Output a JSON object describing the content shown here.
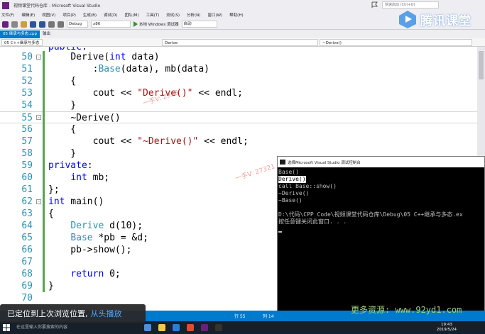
{
  "titlebar": {
    "title": "视频课堂代码仓库 - Microsoft Visual Studio",
    "quick_launch": "快速启动 (Ctrl+Q)"
  },
  "menubar": {
    "items": [
      "文件(F)",
      "编辑(E)",
      "视图(V)",
      "项目(P)",
      "生成(B)",
      "调试(D)",
      "团队(M)",
      "工具(T)",
      "测试(S)",
      "分析(N)",
      "窗口(W)",
      "帮助(H)"
    ]
  },
  "toolbar": {
    "config": "Debug",
    "platform": "x86",
    "run_label": "本地 Windows 调试器",
    "run_mode": "自动"
  },
  "logo": {
    "text": "腾讯课堂"
  },
  "doctabs": [
    {
      "label": "05 继承与多态.cpp",
      "active": true
    },
    {
      "label": "输出",
      "active": false
    }
  ],
  "navbar": {
    "project": "05 C++继承与多态",
    "scope": "Derive",
    "member": "~Derive()"
  },
  "code": [
    {
      "n": "50",
      "tokens": [
        [
          "",
          "    "
        ],
        [
          "",
          "Derive("
        ],
        [
          "kw",
          "int"
        ],
        [
          "",
          " data)"
        ]
      ]
    },
    {
      "n": "51",
      "tokens": [
        [
          "",
          "        :"
        ],
        [
          "cls",
          "Base"
        ],
        [
          "",
          "(data), mb(data)"
        ]
      ]
    },
    {
      "n": "52",
      "tokens": [
        [
          "",
          "    {"
        ]
      ]
    },
    {
      "n": "53",
      "tokens": [
        [
          "",
          "        cout << "
        ],
        [
          "str",
          "\"Derive()\""
        ],
        [
          "",
          " << endl;"
        ]
      ]
    },
    {
      "n": "54",
      "tokens": [
        [
          "",
          "    }"
        ]
      ]
    },
    {
      "n": "55",
      "tokens": [
        [
          "",
          "    ~Derive()"
        ]
      ]
    },
    {
      "n": "56",
      "tokens": [
        [
          "",
          "    {"
        ]
      ]
    },
    {
      "n": "57",
      "tokens": [
        [
          "",
          "        cout << "
        ],
        [
          "str",
          "\"~Derive()\""
        ],
        [
          "",
          " << endl;"
        ]
      ]
    },
    {
      "n": "58",
      "tokens": [
        [
          "",
          "    }"
        ]
      ]
    },
    {
      "n": "59",
      "tokens": [
        [
          "kw",
          "private"
        ],
        [
          "",
          ":"
        ]
      ]
    },
    {
      "n": "60",
      "tokens": [
        [
          "",
          "    "
        ],
        [
          "kw",
          "int"
        ],
        [
          "",
          " mb;"
        ]
      ]
    },
    {
      "n": "61",
      "tokens": [
        [
          "",
          "};"
        ]
      ]
    },
    {
      "n": "62",
      "tokens": [
        [
          "kw",
          "int"
        ],
        [
          "",
          " main()"
        ]
      ]
    },
    {
      "n": "63",
      "tokens": [
        [
          "",
          "{"
        ]
      ]
    },
    {
      "n": "64",
      "tokens": [
        [
          "",
          "    "
        ],
        [
          "cls",
          "Derive"
        ],
        [
          "",
          " d(10);"
        ]
      ]
    },
    {
      "n": "65",
      "tokens": [
        [
          "",
          "    "
        ],
        [
          "cls",
          "Base"
        ],
        [
          "",
          " *pb = &d;"
        ]
      ]
    },
    {
      "n": "66",
      "tokens": [
        [
          "",
          "    pb->show();"
        ]
      ]
    },
    {
      "n": "67",
      "tokens": [
        [
          "",
          ""
        ]
      ]
    },
    {
      "n": "68",
      "tokens": [
        [
          "",
          "    "
        ],
        [
          "kw",
          "return"
        ],
        [
          "",
          " 0;"
        ]
      ]
    },
    {
      "n": "69",
      "tokens": [
        [
          "",
          "}"
        ]
      ]
    },
    {
      "n": "70",
      "tokens": [
        [
          "",
          ""
        ]
      ]
    }
  ],
  "watermarks": [
    "一手V: 2938",
    "一手V: 27321"
  ],
  "console": {
    "title": "选择Microsoft Visual Studio 调试控制台",
    "lines": [
      "Base()",
      "Derive()",
      "call Base::show()",
      "~Derive()",
      "~Base()",
      "",
      "D:\\代码\\CPP Code\\视频课堂代码仓库\\Debug\\05 C++继承与多态.ex",
      "按任意键关闭此窗口. . ."
    ]
  },
  "statusbar": {
    "line": "行 55",
    "col": "列 14"
  },
  "toast": {
    "message": "已定位到上次浏览位置,",
    "link": "从头播放"
  },
  "more_resources": "更多资源: www.92yd1.com",
  "taskbar": {
    "search_placeholder": "在这里输入你要搜索的内容",
    "time": "19:43",
    "date": "2019/5/24"
  },
  "colors": {
    "accent": "#007acc",
    "keyword": "#0000ff",
    "string": "#a31515",
    "type": "#2b91af",
    "line_number": "#2b91af"
  }
}
